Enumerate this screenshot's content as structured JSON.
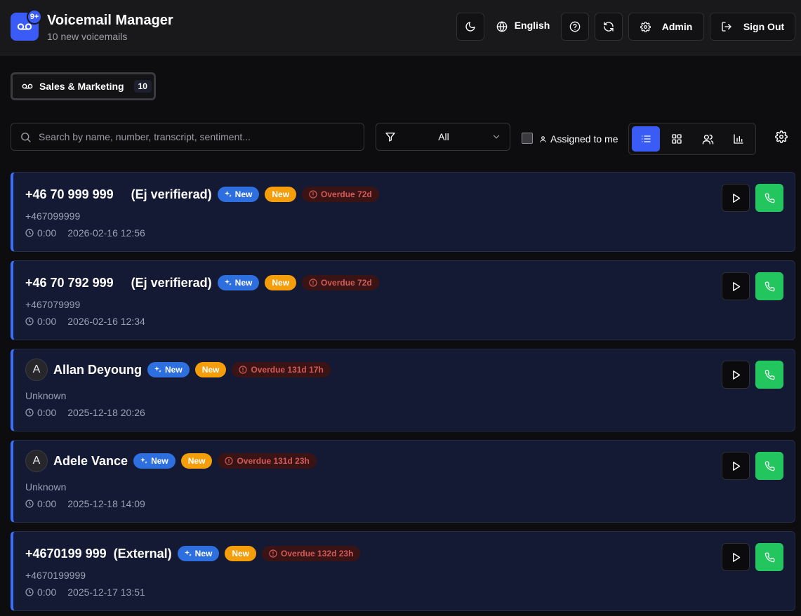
{
  "header": {
    "title": "Voicemail Manager",
    "subtitle": "10 new voicemails",
    "logo_badge": "9+",
    "language": "English",
    "admin_label": "Admin",
    "signout_label": "Sign Out"
  },
  "group_tab": {
    "label": "Sales & Marketing",
    "count": "10"
  },
  "toolbar": {
    "search_placeholder": "Search by name, number, transcript, sentiment...",
    "filter_value": "All",
    "assigned_label": "Assigned to me",
    "active_view": "list"
  },
  "voicemails": [
    {
      "title": "+46 70 999 999     (Ej verifierad)",
      "ai_label": "New",
      "new_label": "New",
      "overdue": "Overdue 72d",
      "number": "+467099999",
      "duration": "0:00",
      "date": "2026-02-16 12:56"
    },
    {
      "title": "+46 70 792 999     (Ej verifierad)",
      "ai_label": "New",
      "new_label": "New",
      "overdue": "Overdue 72d",
      "number": "+467079999",
      "duration": "0:00",
      "date": "2026-02-16 12:34"
    },
    {
      "avatar": "A",
      "title": "Allan Deyoung",
      "ai_label": "New",
      "new_label": "New",
      "overdue": "Overdue 131d 17h",
      "number": "Unknown",
      "duration": "0:00",
      "date": "2025-12-18 20:26"
    },
    {
      "avatar": "A",
      "title": "Adele Vance",
      "ai_label": "New",
      "new_label": "New",
      "overdue": "Overdue 131d 23h",
      "number": "Unknown",
      "duration": "0:00",
      "date": "2025-12-18 14:09"
    },
    {
      "title": "+4670199 999  (External)",
      "ai_label": "New",
      "new_label": "New",
      "overdue": "Overdue 132d 23h",
      "number": "+4670199999",
      "duration": "0:00",
      "date": "2025-12-17 13:51"
    }
  ],
  "colors": {
    "accent": "#3b5bf6",
    "call": "#22c55e",
    "new": "#f59e0b",
    "ai": "#2e6fe0",
    "overdue": "#d35a5a"
  }
}
